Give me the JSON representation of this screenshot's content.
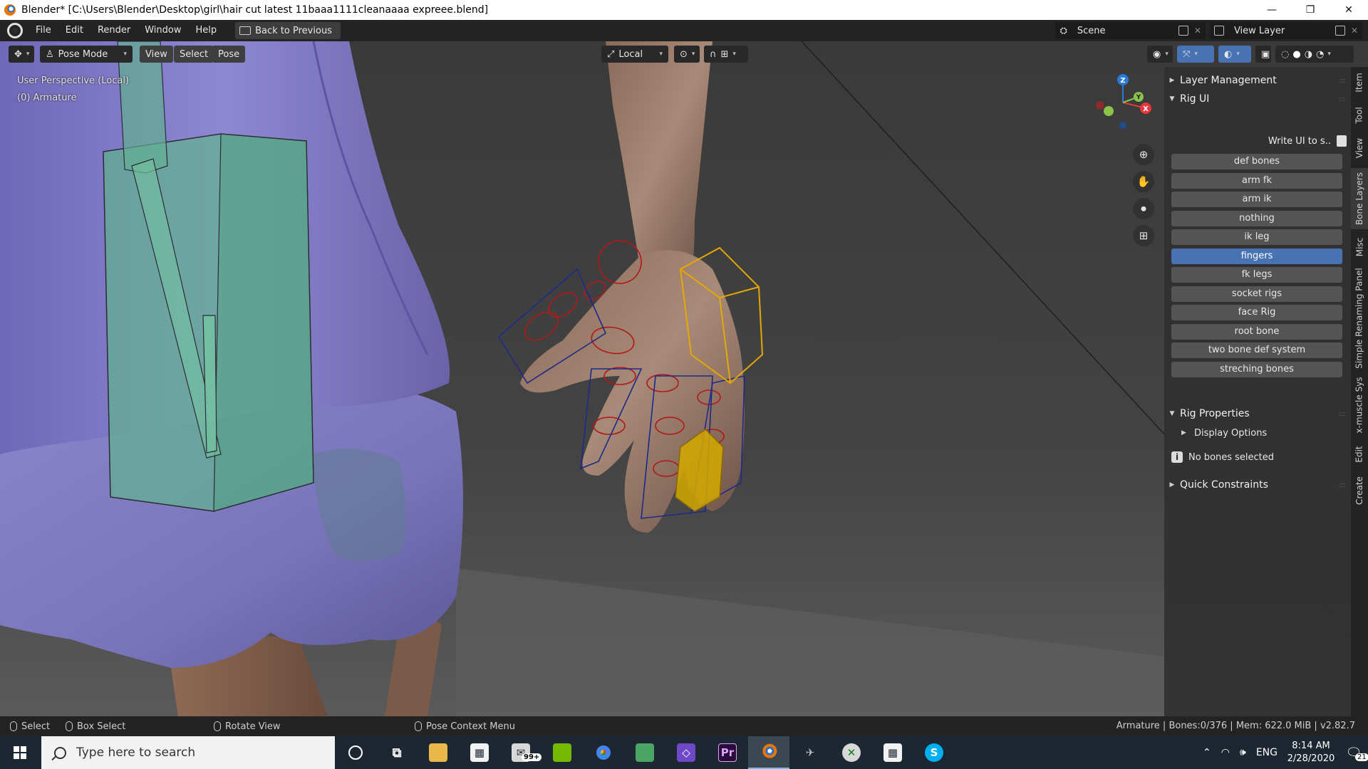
{
  "window": {
    "title": "Blender* [C:\\Users\\Blender\\Desktop\\girl\\hair cut latest 11baaa1111cleanaaaa expreee.blend]",
    "controls": [
      "—",
      "❐",
      "✕"
    ]
  },
  "menubar": {
    "items": [
      "File",
      "Edit",
      "Render",
      "Window",
      "Help"
    ],
    "back_button": "Back to Previous",
    "scene": "Scene",
    "view_layer": "View Layer"
  },
  "viewport_header": {
    "mode": "Pose Mode",
    "menus": [
      "View",
      "Select",
      "Pose"
    ],
    "transform_orientation": "Local"
  },
  "viewport_info": {
    "line1": "User Perspective (Local)",
    "line2": "(0) Armature"
  },
  "gizmo": {
    "x_label": "X",
    "y_label": "Y",
    "z_label": "Z"
  },
  "sidebar": {
    "layer_management": "Layer Management",
    "rig_ui": "Rig UI",
    "write_ui": "Write UI to s..",
    "bone_layers": [
      {
        "label": "def bones",
        "active": false
      },
      {
        "label": "arm fk",
        "active": false
      },
      {
        "label": "arm ik",
        "active": false
      },
      {
        "label": "nothing",
        "active": false
      },
      {
        "label": "ik leg",
        "active": false
      },
      {
        "label": "fingers",
        "active": true
      },
      {
        "label": "fk legs",
        "active": false
      },
      {
        "label": "socket rigs",
        "active": false
      },
      {
        "label": "face Rig",
        "active": false
      },
      {
        "label": "root bone",
        "active": false
      },
      {
        "label": "two bone def system",
        "active": false
      },
      {
        "label": "streching bones",
        "active": false
      }
    ],
    "rig_properties": "Rig Properties",
    "display_options": "Display Options",
    "no_bones": "No bones selected",
    "quick_constraints": "Quick Constraints",
    "tabs": [
      "Item",
      "Tool",
      "View",
      "Bone Layers",
      "Misc",
      "Simple Renaming Panel",
      "x-muscle Sys",
      "Edit",
      "Create"
    ]
  },
  "statusbar": {
    "select": "Select",
    "box_select": "Box Select",
    "rotate_view": "Rotate View",
    "context_menu": "Pose Context Menu",
    "stats": "Armature | Bones:0/376 | Mem: 622.0 MiB | v2.82.7"
  },
  "taskbar": {
    "search_placeholder": "Type here to search",
    "mail_badge": "99+",
    "premiere_label": "Pr",
    "skype_label": "S",
    "language": "ENG",
    "time": "8:14 AM",
    "date": "2/28/2020",
    "notification_count": "21"
  },
  "colors": {
    "active_button": "#4772b3",
    "gizmo_x": "#e8383d",
    "gizmo_y": "#8bc34a",
    "gizmo_z": "#2b7bd4",
    "bone_selected": "#e6a800",
    "bone_green": "#5db889"
  }
}
